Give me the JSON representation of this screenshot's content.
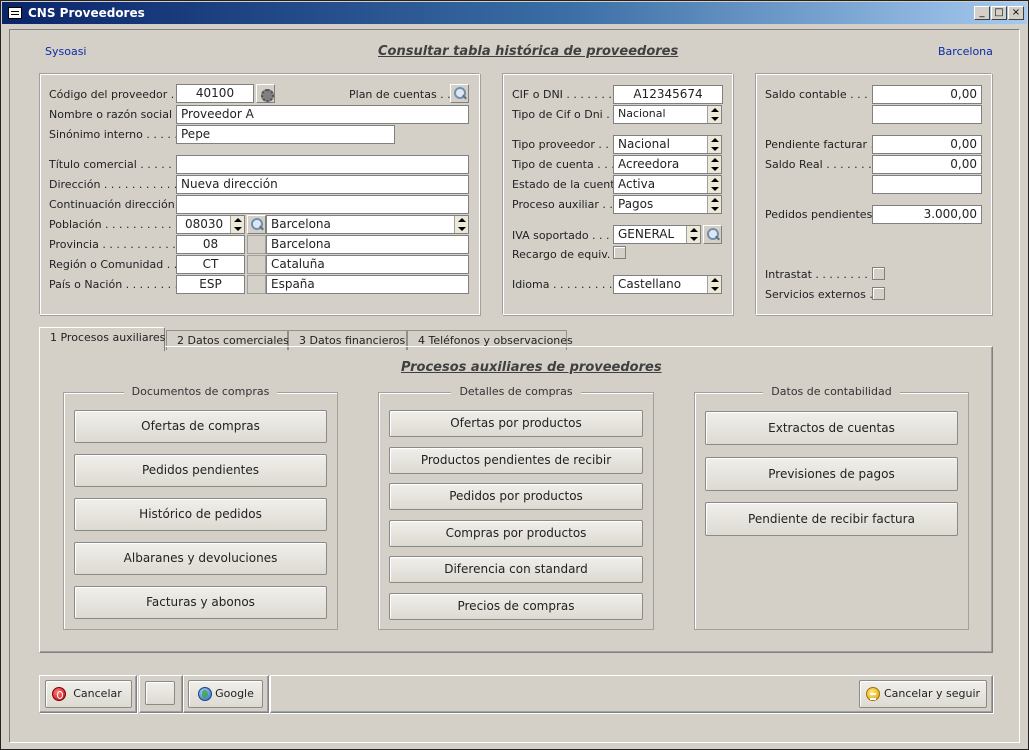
{
  "window": {
    "title": "CNS Proveedores"
  },
  "header": {
    "company": "Sysoasi",
    "title": "Consultar tabla histórica de proveedores",
    "city": "Barcelona"
  },
  "supplier": {
    "codigo_label": "Código del proveedor . .",
    "codigo": "40100",
    "plan_label": "Plan de cuentas . . .",
    "nombre_label": "Nombre o razón social .",
    "nombre": "Proveedor A",
    "sinonimo_label": "Sinónimo interno . . . . . .",
    "sinonimo": "Pepe",
    "titulo_label": "Título comercial . . . . . . .",
    "titulo": "",
    "direccion_label": "Dirección . . . . . . . . . . .",
    "direccion": "Nueva dirección",
    "continuacion_label": "Continuación dirección .",
    "continuacion": "",
    "poblacion_label": "Población . . . . . . . . . . .",
    "poblacion_cp": "08030",
    "poblacion": "Barcelona",
    "provincia_label": "Provincia . . . . . . . . . . .",
    "provincia_code": "08",
    "provincia": "Barcelona",
    "region_label": "Región o Comunidad . . .",
    "region_code": "CT",
    "region": "Cataluña",
    "pais_label": "País o Nación . . . . . . . .",
    "pais_code": "ESP",
    "pais": "España"
  },
  "fiscal": {
    "cif_label": "CIF o DNI . . . . . . . .",
    "cif": "A12345674",
    "tipo_cif_label": "Tipo de Cif o Dni . .",
    "tipo_cif": "Nacional",
    "tipo_prov_label": "Tipo proveedor . . . .",
    "tipo_prov": "Nacional",
    "tipo_cuenta_label": "Tipo de cuenta . . . .",
    "tipo_cuenta": "Acreedora",
    "estado_label": "Estado de la cuenta .",
    "estado": "Activa",
    "proceso_label": "Proceso auxiliar . . .",
    "proceso": "Pagos",
    "iva_label": "IVA soportado . . . .",
    "iva": "GENERAL",
    "recargo_label": "Recargo de equiv. . .",
    "idioma_label": "Idioma . . . . . . . . . .",
    "idioma": "Castellano"
  },
  "balances": {
    "saldo_label": "Saldo contable . . . .",
    "saldo": "0,00",
    "saldo2": "",
    "pendiente_label": "Pendiente facturar .",
    "pendiente": "0,00",
    "real_label": "Saldo Real . . . . . . .",
    "real": "0,00",
    "real2": "",
    "pedidos_label": "Pedidos pendientes .",
    "pedidos": "3.000,00",
    "intrastat_label": "Intrastat . . . . . . . .",
    "servicios_label": "Servicios externos . ."
  },
  "tabs": [
    {
      "label": "1  Procesos auxiliares"
    },
    {
      "label": "2  Datos comerciales"
    },
    {
      "label": "3  Datos financieros"
    },
    {
      "label": "4  Teléfonos y observaciones"
    }
  ],
  "tab_panel": {
    "title": "Procesos auxiliares de proveedores",
    "groups": [
      {
        "title": "Documentos de compras",
        "buttons": [
          "Ofertas de compras",
          "Pedidos pendientes",
          "Histórico de pedidos",
          "Albaranes y devoluciones",
          "Facturas y abonos"
        ]
      },
      {
        "title": "Detalles de compras",
        "buttons": [
          "Ofertas por productos",
          "Productos pendientes de recibir",
          "Pedidos por productos",
          "Compras por productos",
          "Diferencia con standard",
          "Precios de compras"
        ]
      },
      {
        "title": "Datos de contabilidad",
        "buttons": [
          "Extractos de cuentas",
          "Previsiones de pagos",
          "Pendiente de recibir factura"
        ]
      }
    ]
  },
  "footer": {
    "cancel": "Cancelar",
    "google": "Google",
    "cancel_continue": "Cancelar y seguir"
  }
}
